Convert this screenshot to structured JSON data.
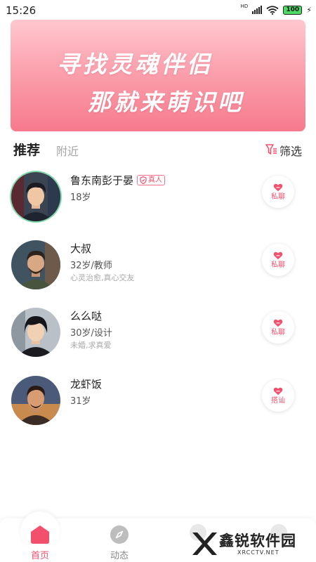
{
  "status_bar": {
    "time": "15:26",
    "network_label": "HD",
    "battery_level": "100"
  },
  "banner": {
    "line1": "寻找灵魂伴侣",
    "line2": "那就来萌识吧"
  },
  "tabs": {
    "active": "推荐",
    "inactive": "附近",
    "filter_label": "筛选"
  },
  "users": [
    {
      "name": "鲁东南彭于晏",
      "badge": "真人",
      "info": "18岁",
      "tag": "",
      "action": "私聊",
      "avatar_ring": true
    },
    {
      "name": "大叔",
      "badge": "",
      "info": "32岁/教师",
      "tag": "心灵治愈,真心交友",
      "action": "私聊",
      "avatar_ring": false
    },
    {
      "name": "么么哒",
      "badge": "",
      "info": "30岁/设计",
      "tag": "未婚,求真爱",
      "action": "私聊",
      "avatar_ring": false
    },
    {
      "name": "龙虾饭",
      "badge": "",
      "info": "31岁",
      "tag": "",
      "action": "搭讪",
      "avatar_ring": false
    }
  ],
  "bottom_nav": {
    "home": "首页",
    "dynamic": "动态"
  },
  "watermark": {
    "text": "鑫锐软件园",
    "sub": "XRCCTV.NET"
  },
  "colors": {
    "accent": "#f3506e",
    "banner_top": "#ffc7cf",
    "banner_bottom": "#f67a8c",
    "avatar_ring": "#7ed9a7"
  }
}
